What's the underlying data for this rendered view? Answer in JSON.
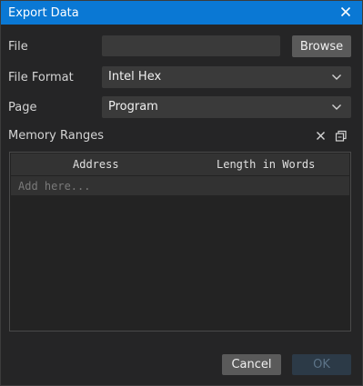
{
  "dialog": {
    "title": "Export Data",
    "close_icon": "close-icon"
  },
  "file": {
    "label": "File",
    "value": "",
    "browse_label": "Browse"
  },
  "file_format": {
    "label": "File Format",
    "selected": "Intel Hex"
  },
  "page": {
    "label": "Page",
    "selected": "Program"
  },
  "memory_ranges": {
    "label": "Memory Ranges",
    "icons": [
      "clear-icon",
      "copy-icon"
    ],
    "columns": [
      "Address",
      "Length in Words"
    ],
    "add_placeholder": "Add here..."
  },
  "footer": {
    "cancel_label": "Cancel",
    "ok_label": "OK",
    "ok_enabled": false
  },
  "colors": {
    "titlebar": "#0a78d4",
    "background": "#252526",
    "button": "#5a5a5a",
    "disabled_button": "#2c3a47"
  }
}
